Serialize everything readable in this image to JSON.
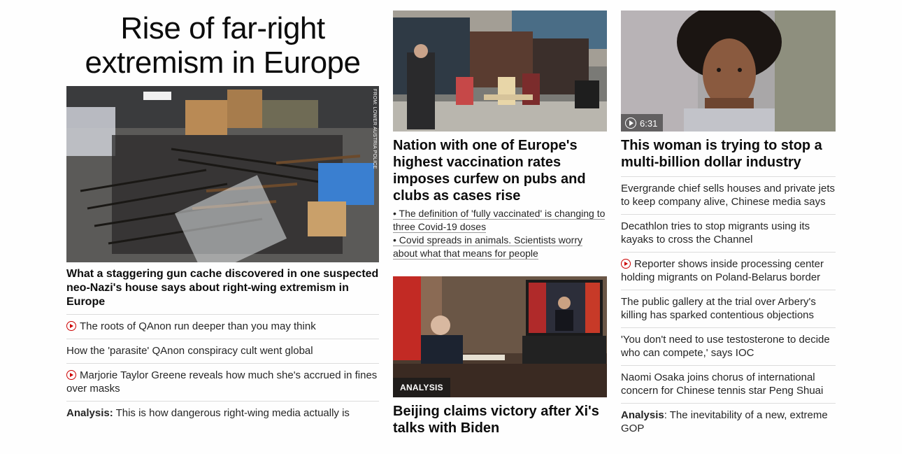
{
  "colors": {
    "accent_red": "#cc0000",
    "text": "#0c0c0c",
    "divider": "#dcdcdc"
  },
  "col1": {
    "zone_title_line1": "Rise of far-right",
    "zone_title_line2": "extremism in Europe",
    "image_credit": "FROM: LOWER AUSTRIA POLICE",
    "headline": "What a staggering gun cache discovered in one suspected neo-Nazi's house says about right-wing extremism in Europe",
    "links": [
      {
        "text": "The roots of QAnon run deeper than you may think",
        "video": true
      },
      {
        "text": "How the 'parasite' QAnon conspiracy cult went global",
        "video": false
      },
      {
        "text": "Marjorie Taylor Greene reveals how much she's accrued in fines over masks",
        "video": true
      },
      {
        "prefix": "Analysis:",
        "text": " This is how dangerous right-wing media actually is",
        "video": false
      }
    ]
  },
  "col2": {
    "headline": "Nation with one of Europe's highest vaccination rates imposes curfew on pubs and clubs as cases rise",
    "bullets": [
      "• The definition of 'fully vaccinated' is changing to three Covid-19 doses",
      "• Covid spreads in animals. Scientists worry about what that means for people"
    ],
    "badge": "ANALYSIS",
    "headline2": "Beijing claims victory after Xi's talks with Biden"
  },
  "col3": {
    "duration": "6:31",
    "headline": "This woman is trying to stop a multi-billion dollar industry",
    "links": [
      {
        "text": "Evergrande chief sells houses and private jets to keep company alive, Chinese media says",
        "video": false
      },
      {
        "text": "Decathlon tries to stop migrants using its kayaks to cross the Channel",
        "video": false
      },
      {
        "text": "Reporter shows inside processing center holding migrants on Poland-Belarus border",
        "video": true
      },
      {
        "text": "The public gallery at the trial over Arbery's killing has sparked contentious objections",
        "video": false
      },
      {
        "text": "'You don't need to use testosterone to decide who can compete,' says IOC",
        "video": false
      },
      {
        "text": "Naomi Osaka joins chorus of international concern for Chinese tennis star Peng Shuai",
        "video": false
      },
      {
        "prefix": "Analysis",
        "text": ": The inevitability of a new, extreme GOP",
        "video": false
      }
    ]
  }
}
